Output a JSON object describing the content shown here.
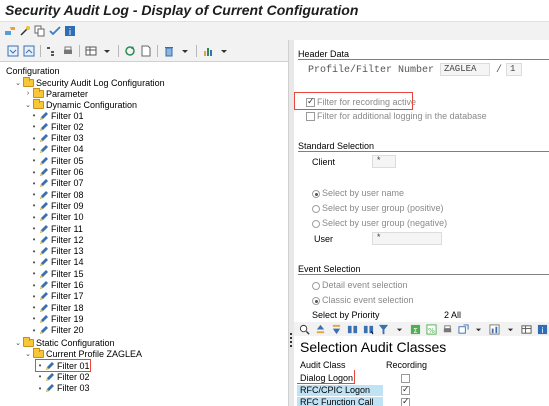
{
  "title": "Security Audit Log - Display of Current Configuration",
  "tree": {
    "header": "Configuration",
    "root": "Security Audit Log Configuration",
    "parameter": "Parameter",
    "dynamic": "Dynamic Configuration",
    "filters": [
      "Filter 01",
      "Filter 02",
      "Filter 03",
      "Filter 04",
      "Filter 05",
      "Filter 06",
      "Filter 07",
      "Filter 08",
      "Filter 09",
      "Filter 10",
      "Filter 11",
      "Filter 12",
      "Filter 13",
      "Filter 14",
      "Filter 15",
      "Filter 16",
      "Filter 17",
      "Filter 18",
      "Filter 19",
      "Filter 20"
    ],
    "static": "Static Configuration",
    "current_profile": "Current Profile ZAGLEA",
    "static_filters": [
      "Filter 01",
      "Filter 02",
      "Filter 03"
    ]
  },
  "header_data": {
    "section": "Header Data",
    "profile_label": "Profile/Filter Number",
    "profile_value": "ZAGLEA",
    "slash": "/",
    "filter_value": "1",
    "chk_recording": "Filter for recording active",
    "chk_recording_checked": true,
    "chk_logging": "Filter for additional logging in the database",
    "chk_logging_checked": false
  },
  "standard_selection": {
    "section": "Standard Selection",
    "client_label": "Client",
    "client_value": "*",
    "radio_user": "Select by user name",
    "radio_group_pos": "Select by user group (positive)",
    "radio_group_neg": "Select by user group (negative)",
    "user_label": "User",
    "user_value": "*"
  },
  "event_selection": {
    "section": "Event Selection",
    "radio_detail": "Detail event selection",
    "radio_classic": "Classic event selection",
    "priority_label": "Select by Priority",
    "priority_value": "2 All"
  },
  "audit_classes": {
    "title": "Selection Audit Classes",
    "col_class": "Audit Class",
    "col_recording": "Recording",
    "rows": [
      {
        "name": "Dialog Logon",
        "recording": false
      },
      {
        "name": "RFC/CPIC Logon",
        "recording": true
      },
      {
        "name": "RFC Function Call",
        "recording": true
      }
    ]
  }
}
